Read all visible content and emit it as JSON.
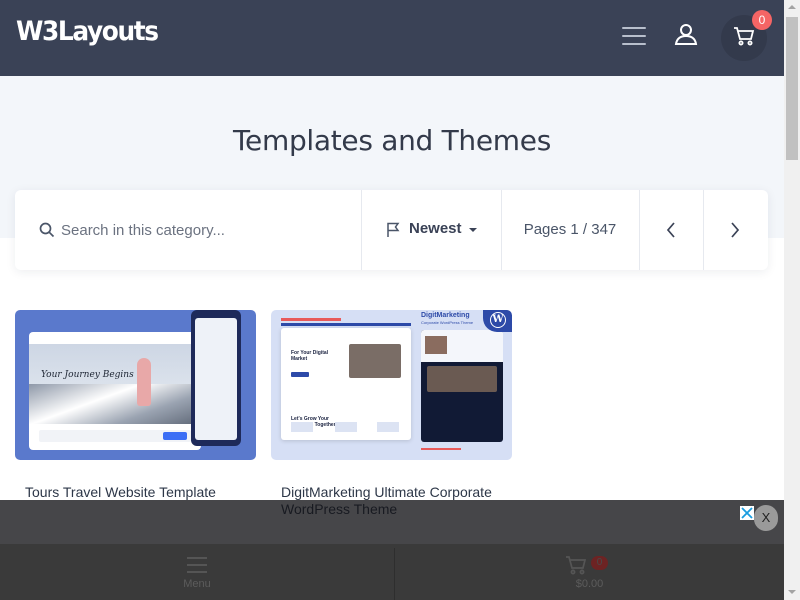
{
  "header": {
    "logo": "W3Layouts",
    "cart_count": "0",
    "icons": {
      "menu": "hamburger-icon",
      "user": "user-icon",
      "cart": "cart-icon"
    }
  },
  "hero": {
    "title": "Templates and Themes"
  },
  "toolbar": {
    "search_placeholder": "Search in this category...",
    "sort_label": "Newest",
    "pages_text": "Pages 1 / 347",
    "icons": {
      "search": "search-icon",
      "sort": "flag-icon",
      "prev": "chevron-left-icon",
      "next": "chevron-right-icon"
    }
  },
  "cards": [
    {
      "title": "Tours Travel Website Template",
      "thumb_script": "Your Journey Begins"
    },
    {
      "title": "DigitMarketing Ultimate Corporate WordPress Theme",
      "thumb_brand": "DigitMarketing",
      "thumb_sub": "Corporate WordPress Theme",
      "thumb_heading": "For Your Digital Market",
      "thumb_heading2": "Let's Grow Your Business Together."
    }
  ],
  "ad": {
    "close_label": "X"
  },
  "bottom_bar": {
    "menu_label": "Menu",
    "cart_count": "0",
    "cart_total": "$0.00"
  },
  "colors": {
    "header_bg": "#3a4256",
    "hero_bg": "#f3f6fa",
    "badge": "#f56565",
    "accent_blue": "#3b6ef5"
  }
}
